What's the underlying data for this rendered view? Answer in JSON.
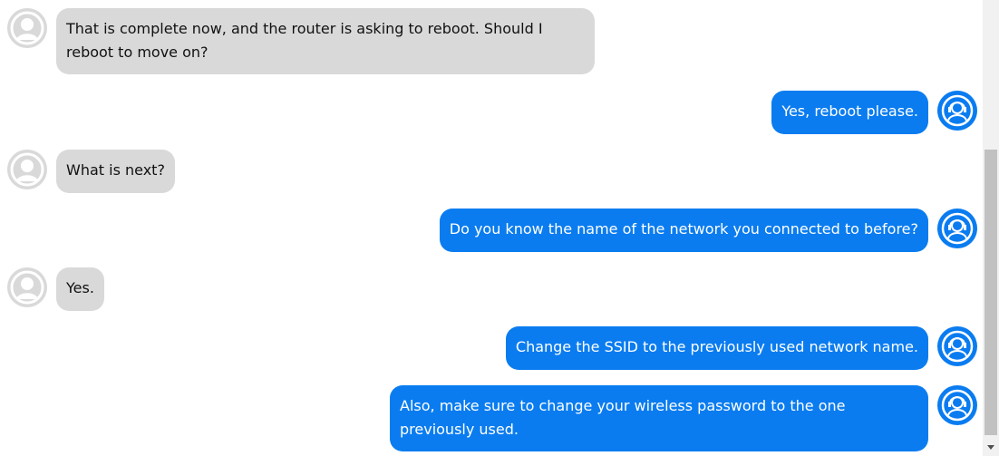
{
  "colors": {
    "user_bubble": "#d9d9d9",
    "agent_bubble": "#0a7cf0",
    "user_avatar": "#d9d9d9",
    "agent_avatar": "#0a7cf0"
  },
  "messages": [
    {
      "sender": "user",
      "text": "That is complete now, and the router is asking to reboot. Should I reboot to move on?",
      "avatar_icon": "user-avatar-icon"
    },
    {
      "sender": "agent",
      "text": "Yes, reboot please.",
      "avatar_icon": "support-agent-icon"
    },
    {
      "sender": "user",
      "text": "What is next?",
      "avatar_icon": "user-avatar-icon"
    },
    {
      "sender": "agent",
      "text": "Do you know the name of the network you connected to before?",
      "avatar_icon": "support-agent-icon"
    },
    {
      "sender": "user",
      "text": "Yes.",
      "avatar_icon": "user-avatar-icon"
    },
    {
      "sender": "agent",
      "text": "Change the SSID to the previously used network name.",
      "avatar_icon": "support-agent-icon"
    },
    {
      "sender": "agent",
      "text": "Also, make sure to change your wireless password to the one previously used.",
      "avatar_icon": "support-agent-icon"
    }
  ],
  "scrollbar": {
    "down_arrow_icon": "chevron-down-icon"
  }
}
